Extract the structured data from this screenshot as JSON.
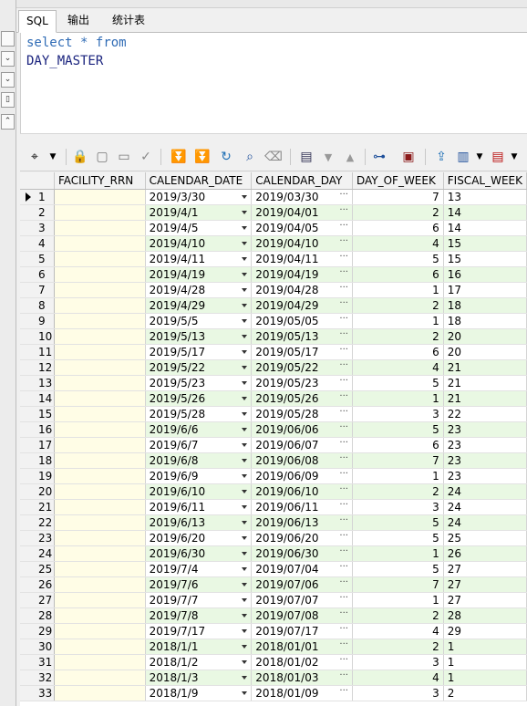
{
  "tabs": [
    {
      "label": "SQL",
      "active": true
    },
    {
      "label": "输出",
      "active": false
    },
    {
      "label": "统计表",
      "active": false
    }
  ],
  "editor": {
    "line1": {
      "kw1": "select",
      "op": "*",
      "kw2": "from"
    },
    "line2": "DAY_MASTER"
  },
  "toolbar_icons": [
    "grid-settings-icon",
    "lock-icon",
    "insert-record-icon",
    "delete-record-icon",
    "post-icon",
    "first-icon",
    "last-icon",
    "refresh-icon",
    "find-icon",
    "clear-icon",
    "filter-icon",
    "sort-desc-icon",
    "sort-asc-icon",
    "tree-icon",
    "save-icon",
    "export-icon",
    "chart-icon",
    "view-icon"
  ],
  "columns": [
    "FACILITY_RRN",
    "CALENDAR_DATE",
    "CALENDAR_DAY",
    "DAY_OF_WEEK",
    "FISCAL_WEEK"
  ],
  "rows": [
    {
      "n": "1",
      "date": "2019/3/30",
      "day": "2019/03/30",
      "dow": "7",
      "fw": "13"
    },
    {
      "n": "2",
      "date": "2019/4/1",
      "day": "2019/04/01",
      "dow": "2",
      "fw": "14"
    },
    {
      "n": "3",
      "date": "2019/4/5",
      "day": "2019/04/05",
      "dow": "6",
      "fw": "14"
    },
    {
      "n": "4",
      "date": "2019/4/10",
      "day": "2019/04/10",
      "dow": "4",
      "fw": "15"
    },
    {
      "n": "5",
      "date": "2019/4/11",
      "day": "2019/04/11",
      "dow": "5",
      "fw": "15"
    },
    {
      "n": "6",
      "date": "2019/4/19",
      "day": "2019/04/19",
      "dow": "6",
      "fw": "16"
    },
    {
      "n": "7",
      "date": "2019/4/28",
      "day": "2019/04/28",
      "dow": "1",
      "fw": "17"
    },
    {
      "n": "8",
      "date": "2019/4/29",
      "day": "2019/04/29",
      "dow": "2",
      "fw": "18"
    },
    {
      "n": "9",
      "date": "2019/5/5",
      "day": "2019/05/05",
      "dow": "1",
      "fw": "18"
    },
    {
      "n": "10",
      "date": "2019/5/13",
      "day": "2019/05/13",
      "dow": "2",
      "fw": "20"
    },
    {
      "n": "11",
      "date": "2019/5/17",
      "day": "2019/05/17",
      "dow": "6",
      "fw": "20"
    },
    {
      "n": "12",
      "date": "2019/5/22",
      "day": "2019/05/22",
      "dow": "4",
      "fw": "21"
    },
    {
      "n": "13",
      "date": "2019/5/23",
      "day": "2019/05/23",
      "dow": "5",
      "fw": "21"
    },
    {
      "n": "14",
      "date": "2019/5/26",
      "day": "2019/05/26",
      "dow": "1",
      "fw": "21"
    },
    {
      "n": "15",
      "date": "2019/5/28",
      "day": "2019/05/28",
      "dow": "3",
      "fw": "22"
    },
    {
      "n": "16",
      "date": "2019/6/6",
      "day": "2019/06/06",
      "dow": "5",
      "fw": "23"
    },
    {
      "n": "17",
      "date": "2019/6/7",
      "day": "2019/06/07",
      "dow": "6",
      "fw": "23"
    },
    {
      "n": "18",
      "date": "2019/6/8",
      "day": "2019/06/08",
      "dow": "7",
      "fw": "23"
    },
    {
      "n": "19",
      "date": "2019/6/9",
      "day": "2019/06/09",
      "dow": "1",
      "fw": "23"
    },
    {
      "n": "20",
      "date": "2019/6/10",
      "day": "2019/06/10",
      "dow": "2",
      "fw": "24"
    },
    {
      "n": "21",
      "date": "2019/6/11",
      "day": "2019/06/11",
      "dow": "3",
      "fw": "24"
    },
    {
      "n": "22",
      "date": "2019/6/13",
      "day": "2019/06/13",
      "dow": "5",
      "fw": "24"
    },
    {
      "n": "23",
      "date": "2019/6/20",
      "day": "2019/06/20",
      "dow": "5",
      "fw": "25"
    },
    {
      "n": "24",
      "date": "2019/6/30",
      "day": "2019/06/30",
      "dow": "1",
      "fw": "26"
    },
    {
      "n": "25",
      "date": "2019/7/4",
      "day": "2019/07/04",
      "dow": "5",
      "fw": "27"
    },
    {
      "n": "26",
      "date": "2019/7/6",
      "day": "2019/07/06",
      "dow": "7",
      "fw": "27"
    },
    {
      "n": "27",
      "date": "2019/7/7",
      "day": "2019/07/07",
      "dow": "1",
      "fw": "27"
    },
    {
      "n": "28",
      "date": "2019/7/8",
      "day": "2019/07/08",
      "dow": "2",
      "fw": "28"
    },
    {
      "n": "29",
      "date": "2019/7/17",
      "day": "2019/07/17",
      "dow": "4",
      "fw": "29"
    },
    {
      "n": "30",
      "date": "2018/1/1",
      "day": "2018/01/01",
      "dow": "2",
      "fw": "1"
    },
    {
      "n": "31",
      "date": "2018/1/2",
      "day": "2018/01/02",
      "dow": "3",
      "fw": "1"
    },
    {
      "n": "32",
      "date": "2018/1/3",
      "day": "2018/01/03",
      "dow": "4",
      "fw": "1"
    },
    {
      "n": "33",
      "date": "2018/1/9",
      "day": "2018/01/09",
      "dow": "3",
      "fw": "2"
    }
  ],
  "current_row": 1,
  "colors": {
    "even_row": "#e9f8e3",
    "facility_bg": "#fffde6",
    "keyword": "#2f6bb5"
  }
}
